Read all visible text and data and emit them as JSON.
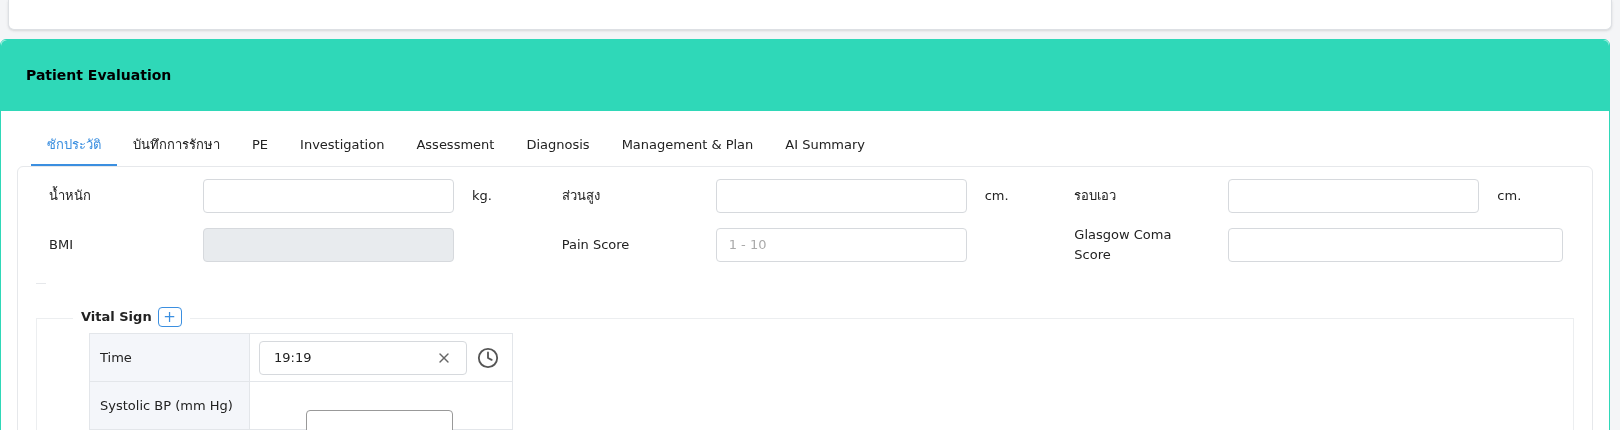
{
  "section": {
    "title": "Patient Evaluation"
  },
  "tabs": [
    {
      "label": "ซักประวัติ",
      "selected": true
    },
    {
      "label": "บันทึกการรักษา",
      "selected": false
    },
    {
      "label": "PE",
      "selected": false
    },
    {
      "label": "Investigation",
      "selected": false
    },
    {
      "label": "Assessment",
      "selected": false
    },
    {
      "label": "Diagnosis",
      "selected": false
    },
    {
      "label": "Management & Plan",
      "selected": false
    },
    {
      "label": "AI Summary",
      "selected": false
    }
  ],
  "measurements": [
    [
      {
        "label": "น้ำหนัก",
        "unit": "kg.",
        "disabled": false
      },
      {
        "label": "ส่วนสูง",
        "unit": "cm.",
        "disabled": false
      },
      {
        "label": "รอบเอว",
        "unit": "cm.",
        "disabled": false
      }
    ],
    [
      {
        "label": "BMI",
        "disabled": true
      },
      {
        "label": "Pain Score",
        "placeholder": "1 - 10",
        "disabled": false
      },
      {
        "label": "Glasgow Coma Score",
        "disabled": false
      }
    ]
  ],
  "vital_sign": {
    "title": "Vital Sign",
    "add_button": "+",
    "rows": [
      {
        "label": "Time",
        "kind": "time",
        "value": "19:19"
      },
      {
        "label": "Systolic BP (mm Hg)",
        "kind": "number"
      }
    ]
  }
}
